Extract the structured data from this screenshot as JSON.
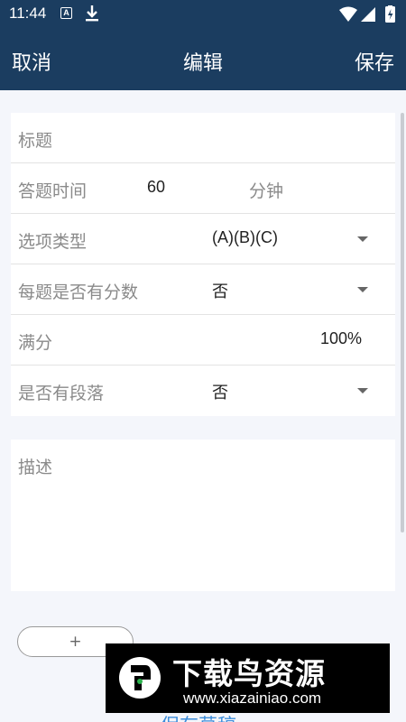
{
  "status_bar": {
    "time": "11:44",
    "icons": [
      "a-notification-icon",
      "download-icon",
      "wifi-icon",
      "signal-icon",
      "battery-icon"
    ]
  },
  "app_bar": {
    "cancel_label": "取消",
    "title": "编辑",
    "save_label": "保存"
  },
  "form": {
    "title_placeholder": "标题",
    "duration": {
      "label": "答题时间",
      "value": "60",
      "unit": "分钟"
    },
    "option_type": {
      "label": "选项类型",
      "value": "(A)(B)(C)"
    },
    "score_per_question": {
      "label": "每题是否有分数",
      "value": "否"
    },
    "full_score": {
      "label": "满分",
      "value": "100%"
    },
    "has_paragraphs": {
      "label": "是否有段落",
      "value": "否"
    }
  },
  "description": {
    "placeholder": "描述"
  },
  "add_button": {
    "label": "+"
  },
  "save_draft_label": "保存草稿",
  "watermark": {
    "title": "下载鸟资源",
    "url": "www.xiazainiao.com"
  },
  "colors": {
    "app_bar": "#1b3d60",
    "background": "#f4f6fb",
    "link": "#3d8ddb"
  }
}
